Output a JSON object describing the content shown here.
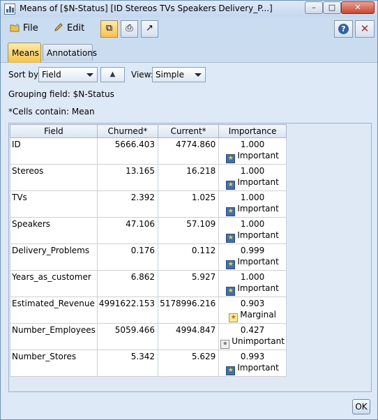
{
  "window": {
    "title": "Means of [$N-Status] [ID Stereos TVs Speakers Delivery_P...]",
    "min_glyph": "–",
    "max_glyph": "□",
    "close_glyph": "✕"
  },
  "menu": {
    "file": "File",
    "edit": "Edit"
  },
  "tabs": {
    "means": "Means",
    "annotations": "Annotations"
  },
  "controls": {
    "sort_by_label": "Sort by:",
    "sort_by_value": "Field",
    "sort_dir_glyph": "▲",
    "view_label": "View:",
    "view_value": "Simple"
  },
  "info": {
    "grouping": "Grouping field: $N-Status",
    "cells": "*Cells contain: Mean"
  },
  "table": {
    "headers": {
      "field": "Field",
      "churned": "Churned*",
      "current": "Current*",
      "importance": "Importance"
    },
    "rows": [
      {
        "field": "ID",
        "churned": "5666.403",
        "current": "4774.860",
        "importance": "1.000",
        "label": "Important"
      },
      {
        "field": "Stereos",
        "churned": "13.165",
        "current": "16.218",
        "importance": "1.000",
        "label": "Important"
      },
      {
        "field": "TVs",
        "churned": "2.392",
        "current": "1.025",
        "importance": "1.000",
        "label": "Important"
      },
      {
        "field": "Speakers",
        "churned": "47.106",
        "current": "57.109",
        "importance": "1.000",
        "label": "Important"
      },
      {
        "field": "Delivery_Problems",
        "churned": "0.176",
        "current": "0.112",
        "importance": "0.999",
        "label": "Important"
      },
      {
        "field": "Years_as_customer",
        "churned": "6.862",
        "current": "5.927",
        "importance": "1.000",
        "label": "Important"
      },
      {
        "field": "Estimated_Revenue",
        "churned": "4991622.153",
        "current": "5178996.216",
        "importance": "0.903",
        "label": "Marginal"
      },
      {
        "field": "Number_Employees",
        "churned": "5059.466",
        "current": "4994.847",
        "importance": "0.427",
        "label": "Unimportant"
      },
      {
        "field": "Number_Stores",
        "churned": "5.342",
        "current": "5.629",
        "importance": "0.993",
        "label": "Important"
      }
    ]
  },
  "buttons": {
    "ok": "OK"
  }
}
